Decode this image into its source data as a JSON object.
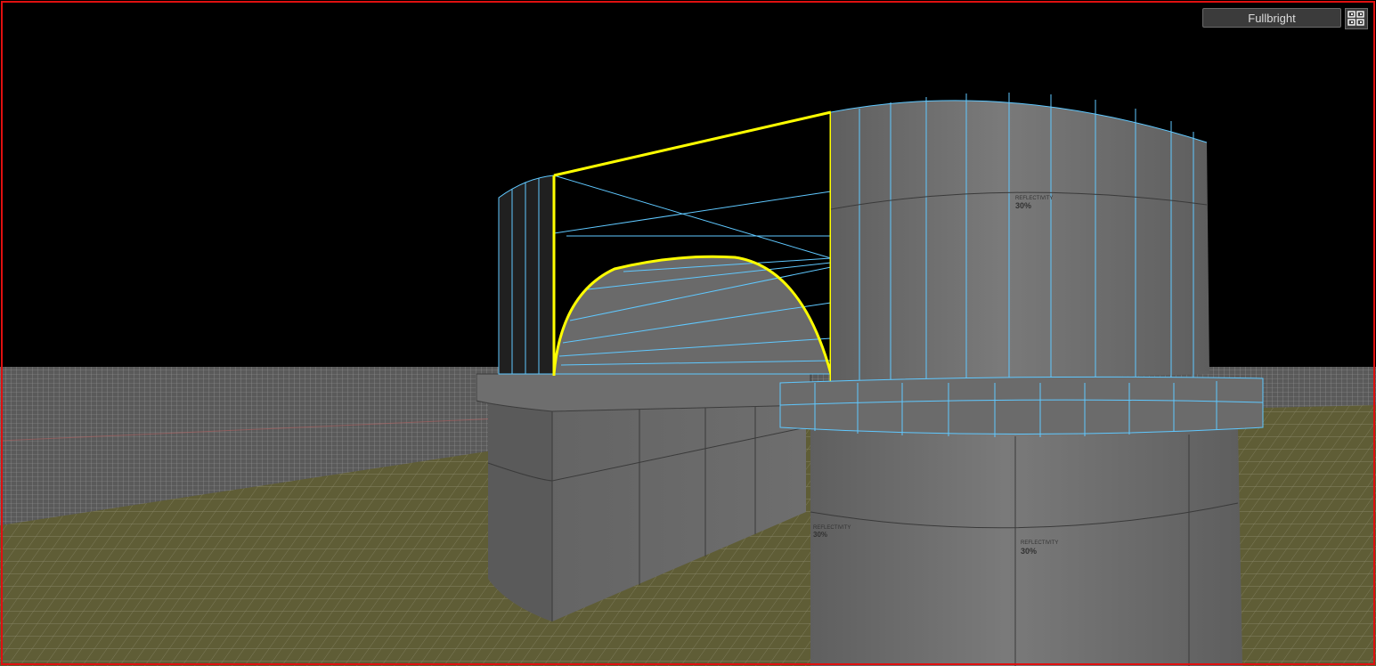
{
  "viewport": {
    "render_mode": "Fullbright",
    "selection_color": "#ffff00",
    "wireframe_color": "#5fc8ff",
    "border_color": "#e01010"
  },
  "textures": {
    "label_title": "REFLECTIVITY",
    "label_value": "30%"
  },
  "icons": {
    "layout_toggle": "grid-layout-icon"
  }
}
